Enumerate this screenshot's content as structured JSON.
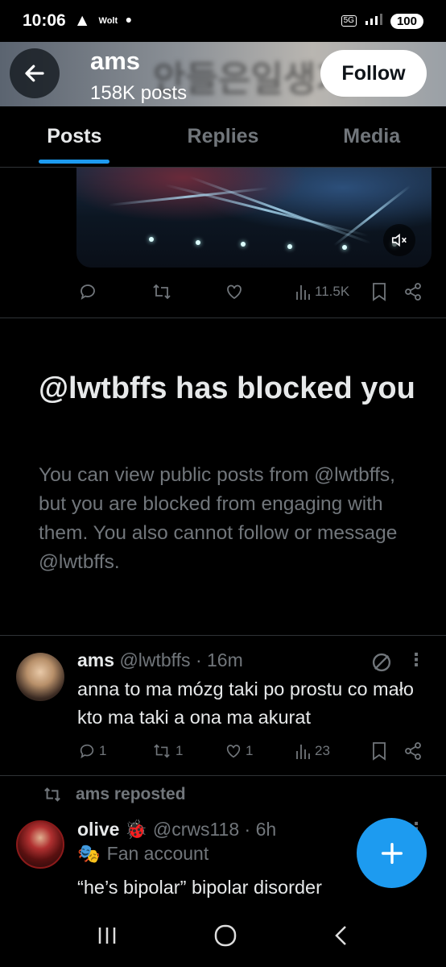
{
  "status_bar": {
    "time": "10:06",
    "app_label": "Wolt",
    "network": "5G",
    "battery": "100"
  },
  "header": {
    "title": "ams",
    "posts_count": "158K posts",
    "follow_label": "Follow",
    "banner_text": "안들은일생기"
  },
  "tabs": [
    {
      "label": "Posts"
    },
    {
      "label": "Replies"
    },
    {
      "label": "Media"
    }
  ],
  "video_post": {
    "views": "11.5K"
  },
  "blocked": {
    "title": "@lwtbffs has blocked you",
    "body": "You can view public posts from @lwtbffs, but you are blocked from engaging with them. You also cannot follow or message @lwtbffs."
  },
  "tweet1": {
    "name": "ams",
    "handle": "@lwtbffs",
    "time": "· 16m",
    "text": "anna to ma mózg taki po prostu co mało kto ma taki a ona ma akurat",
    "replies": "1",
    "reposts": "1",
    "likes": "1",
    "views": "23"
  },
  "repost_line": {
    "label": "ams reposted"
  },
  "tweet2": {
    "name": "olive",
    "handle": "@crws118",
    "time": "· 6h",
    "badge": "Fan account",
    "text": "“he’s bipolar” bipolar disorder"
  },
  "colors": {
    "accent": "#1d9bf0",
    "muted": "#71767b",
    "text": "#e7e9ea",
    "divider": "#2f3336"
  },
  "icons": [
    "back-arrow-icon",
    "mute-icon",
    "reply-icon",
    "repost-icon",
    "like-icon",
    "views-icon",
    "bookmark-icon",
    "share-icon",
    "more-icon",
    "no-entry-icon",
    "compose-plus-icon"
  ]
}
